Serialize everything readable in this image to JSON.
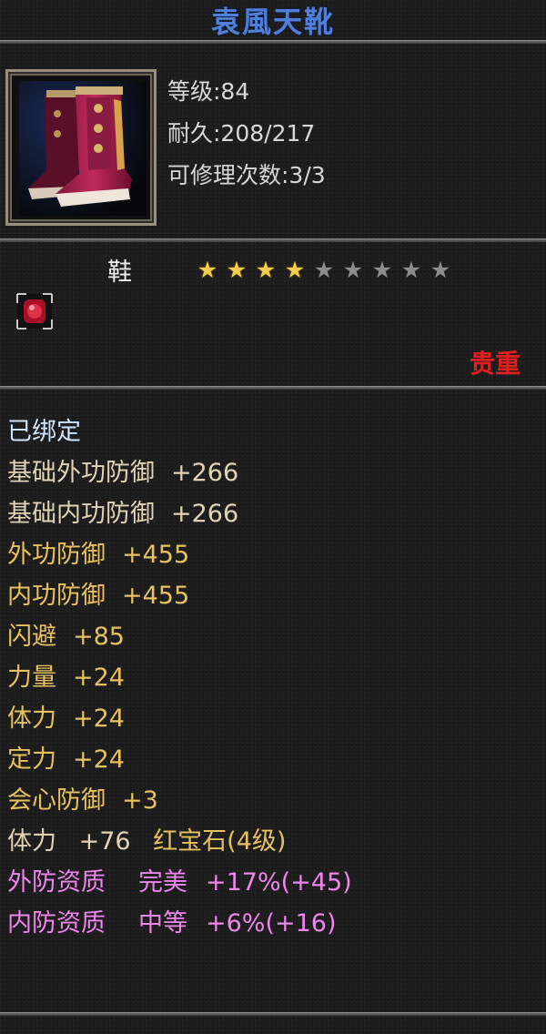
{
  "item": {
    "name": "袁風天靴",
    "level": "等级:84",
    "durability": "耐久:208/217",
    "repair": "可修理次数:3/3",
    "type": "鞋",
    "stars_filled": 4,
    "stars_total": 9,
    "rarity": "贵重"
  },
  "stats": {
    "bound": "已绑定",
    "lines": [
      {
        "label": "基础外功防御",
        "value": "+266",
        "style": "tan"
      },
      {
        "label": "基础内功防御",
        "value": "+266",
        "style": "tan"
      },
      {
        "label": "外功防御",
        "value": "+455",
        "style": "gold"
      },
      {
        "label": "内功防御",
        "value": "+455",
        "style": "gold"
      },
      {
        "label": "闪避",
        "value": "+85",
        "style": "gold"
      },
      {
        "label": "力量",
        "value": "+24",
        "style": "gold"
      },
      {
        "label": "体力",
        "value": "+24",
        "style": "gold"
      },
      {
        "label": "定力",
        "value": "+24",
        "style": "gold"
      },
      {
        "label": "会心防御",
        "value": "+3",
        "style": "gold"
      }
    ],
    "gem": {
      "label": "体力",
      "value": "+76",
      "gem_name": "红宝石(4级)"
    },
    "quality": [
      {
        "label": "外防资质",
        "grade": "完美",
        "detail": "+17%(+45)"
      },
      {
        "label": "内防资质",
        "grade": "中等",
        "detail": "+6%(+16)"
      }
    ]
  },
  "colors": {
    "title": "#4f7fd8",
    "rarity": "#e02020",
    "star_on": "#f1cf4a",
    "star_off": "#8d8d8d",
    "bound": "#cfe6ff",
    "base_stat": "#e2d2b6",
    "stat": "#e8c160",
    "quality": "#ee86ee"
  },
  "icons": {
    "item": "boots-icon",
    "gem_slot": "ruby-gem-icon"
  }
}
